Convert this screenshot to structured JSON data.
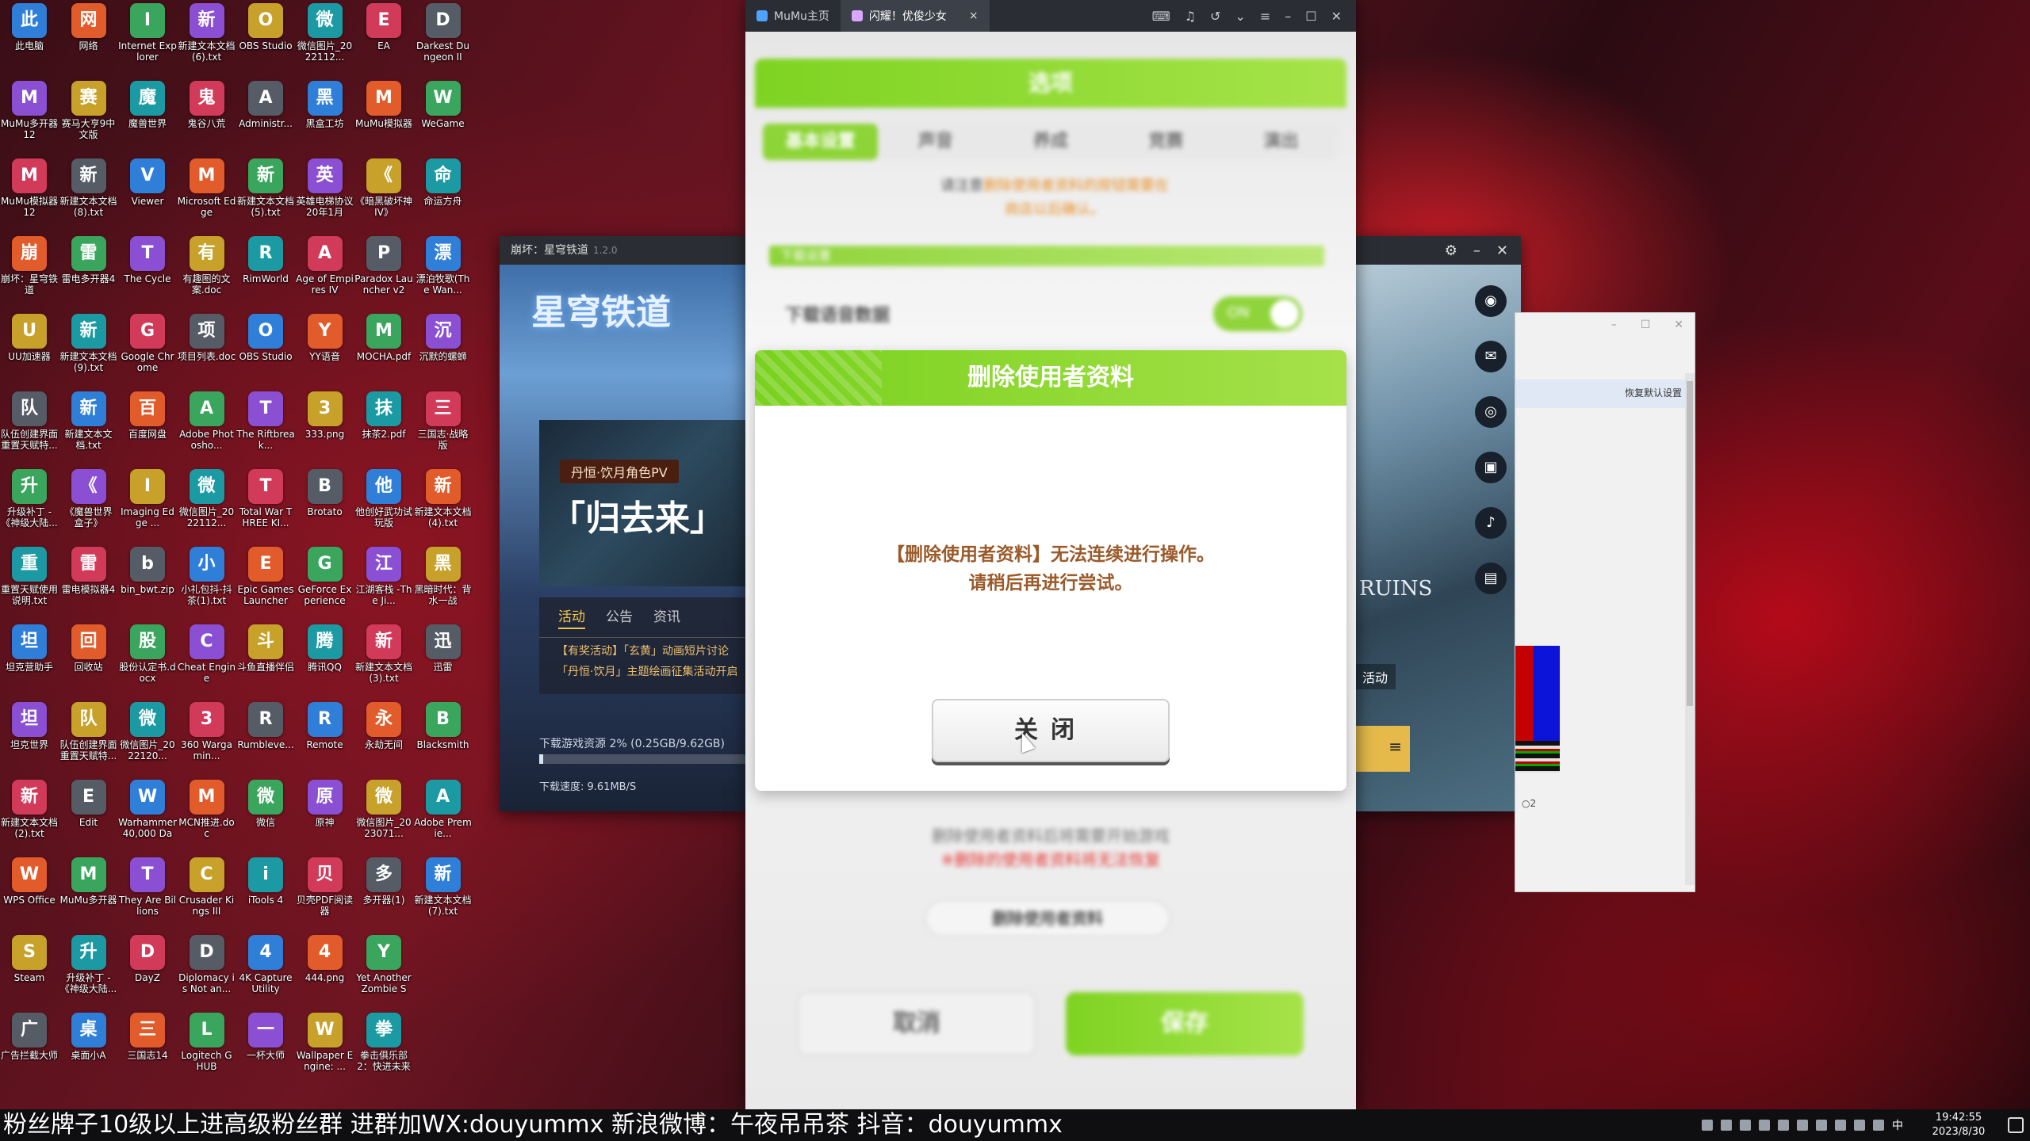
{
  "desktop_icons": [
    [
      "此电脑",
      "网络",
      "Internet Explorer",
      "新建文本文档 (6).txt",
      "OBS Studio",
      "微信图片_2022112...",
      "EA",
      "Darkest Dungeon II"
    ],
    [
      "MuMu多开器12",
      "赛马大亨9中文版",
      "魔兽世界",
      "鬼谷八荒",
      "Administr...",
      "黑盒工坊",
      "MuMu模拟器",
      "WeGame"
    ],
    [
      "MuMu模拟器12",
      "新建文本文档 (8).txt",
      "Viewer",
      "Microsoft Edge",
      "新建文本文档 (5).txt",
      "英雄电梯协议20年1月",
      "《暗黑破坏神IV》",
      "命运方舟"
    ],
    [
      "崩坏：星穹铁道",
      "雷电多开器4",
      "The Cycle",
      "有趣图的文案.doc",
      "RimWorld",
      "Age of Empires IV",
      "Paradox Launcher v2",
      "漂泊牧歌(The Wan..."
    ],
    [
      "UU加速器",
      "新建文本文档 (9).txt",
      "Google Chrome",
      "项目列表.doc",
      "OBS Studio",
      "YY语音",
      "MOCHA.pdf",
      "沉默的螺蛳"
    ],
    [
      "队伍创建界面重置天赋特...",
      "新建文本文档.txt",
      "百度网盘",
      "Adobe Photosho...",
      "The Riftbreak...",
      "333.png",
      "抹茶2.pdf",
      "三国志·战略版"
    ],
    [
      "升级补丁 - 《神级大陆...",
      "《魔兽世界 盒子》",
      "Imaging Edge ...",
      "微信图片_2022112...",
      "Total War THREE KI...",
      "Brotato",
      "他创好武功试玩版",
      "新建文本文档 (4).txt"
    ],
    [
      "重置天赋使用说明.txt",
      "雷电模拟器4",
      "bin_bwt.zip",
      "小礼包抖-抖茶(1).txt",
      "Epic Games Launcher",
      "GeForce Experience",
      "江湖客栈 -The Ji...",
      "黑暗时代：背水一战"
    ],
    [
      "坦克营助手",
      "回收站",
      "股份认定书.docx",
      "Cheat Engine",
      "斗鱼直播伴侣",
      "腾讯QQ",
      "新建文本文档 (3).txt",
      "迅雷"
    ],
    [
      "坦克世界",
      "队伍创建界面重置天赋特...",
      "微信图片_2022120...",
      "360 Wargamin...",
      "Rumbleve...",
      "Remote",
      "永劫无间",
      "Blacksmith"
    ],
    [
      "新建文本文档 (2).txt",
      "Edit",
      "Warhammer 40,000 Dar...",
      "MCN推进.doc",
      "微信",
      "原神",
      "微信图片_2023071...",
      "Adobe Premie..."
    ],
    [
      "WPS Office",
      "MuMu多开器",
      "They Are Billions",
      "Crusader Kings III",
      "iTools 4",
      "贝壳PDF阅读器",
      "多开器(1)",
      "新建文本文档 (7).txt"
    ],
    [
      "Steam",
      "升级补丁 - 《神级大陆...",
      "DayZ",
      "Diplomacy is Not an...",
      "4K Capture Utility",
      "444.png",
      "Yet Another Zombie Su...",
      ""
    ],
    [
      "广告拦截大师",
      "桌面小A",
      "三国志14",
      "Logitech G HUB",
      "一杯大师",
      "Wallpaper Engine: ...",
      "拳击俱乐部2：快进未来",
      ""
    ]
  ],
  "launcher": {
    "title": "崩坏：星穹铁道",
    "version": "1.2.0",
    "logo_text": "星穹铁道",
    "banner_pill": "丹恒·饮月角色PV",
    "banner_title": "「归去来」",
    "tabs": [
      "活动",
      "公告",
      "资讯"
    ],
    "news": [
      "【有奖活动】「玄黄」动画短片讨论",
      "「丹恒·饮月」主题绘画征集活动开启"
    ],
    "download_text": "下载游戏资源 2% (0.25GB/9.62GB)",
    "progress_fraction": 0.02,
    "speed_text": "下载速度: 9.61MB/S"
  },
  "sidepanel": {
    "social_icons": [
      "hoyolab-icon",
      "wechat-icon",
      "weibo-icon",
      "bilibili-icon",
      "notification-icon",
      "chat-icon"
    ],
    "art_text": "RUINS",
    "activity_text": "活动",
    "menu_icon": "≡"
  },
  "graywin": {
    "restore_text": "恢复默认设置",
    "radio_text": "2"
  },
  "mumu": {
    "tab1": "MuMu主页",
    "tab2": "闪耀！优俊少女",
    "tab_close": "×"
  },
  "settings_bg": {
    "title": "选项",
    "tabs": [
      "基本设置",
      "声音",
      "养成",
      "竞赛",
      "演出"
    ],
    "note_prefix": "请注意",
    "note_hl1": "删除使用者资料的按钮需要在",
    "note_hl2": "商店以后确认。",
    "green_bar": "下载设置",
    "row_label": "下载语音数据",
    "toggle_text": "ON",
    "warn_line1": "删除使用者资料后将需要开始游戏",
    "warn_line2": "※删除的使用者资料将无法恢复",
    "delete_btn": "删除使用者资料",
    "cancel_btn": "取消",
    "save_btn": "保存"
  },
  "dialog": {
    "title": "删除使用者资料",
    "message_line1": "【删除使用者资料】无法连续进行操作。",
    "message_line2": "请稍后再进行尝试。",
    "close_label": "关闭"
  },
  "taskbar": {
    "marquee": "粉丝牌子10级以上进高级粉丝群  进群加WX:douyummx 新浪微博：午夜吊吊茶    抖音：douyummx",
    "time": "19:42:55",
    "date": "2023/8/30",
    "ime": "中"
  },
  "colors": {
    "accent_green": "#8dd437",
    "dialog_text": "#9a5a2a"
  }
}
